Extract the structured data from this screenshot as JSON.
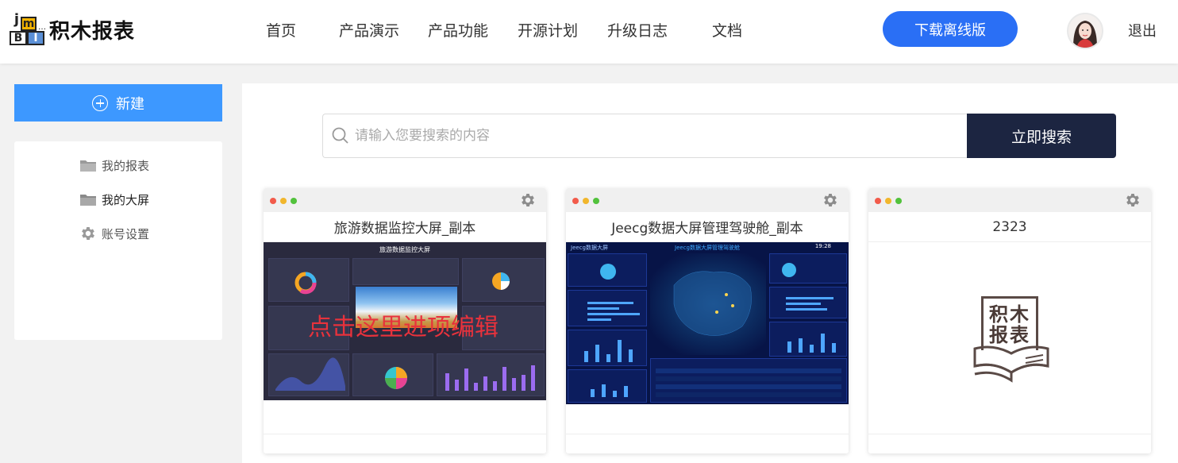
{
  "header": {
    "logo_text": "积木报表",
    "logo_blocks": [
      "j",
      "m",
      "B",
      "I"
    ],
    "nav": [
      "首页",
      "产品演示",
      "产品功能",
      "开源计划",
      "升级日志",
      "文档"
    ],
    "download_label": "下载离线版",
    "logout_label": "退出",
    "accent": "#2a6ff5"
  },
  "sidebar": {
    "new_label": "新建",
    "items": [
      {
        "label": "我的报表",
        "icon": "folder-icon"
      },
      {
        "label": "我的大屏",
        "icon": "folder-icon",
        "active": true
      },
      {
        "label": "账号设置",
        "icon": "gear-icon"
      }
    ]
  },
  "search": {
    "placeholder": "请输入您要搜索的内容",
    "value": "",
    "button_label": "立即搜索"
  },
  "cards": [
    {
      "title": "旅游数据监控大屏_副本",
      "thumb_title": "旅游数据监控大屏",
      "overlay_text": "点击这里进项编辑"
    },
    {
      "title": "Jeecg数据大屏管理驾驶舱_副本",
      "thumb_title": "Jeecg数据大屏管理驾驶舱",
      "thumb_brand": "Jeecg数据大屏",
      "thumb_time": "19:28"
    },
    {
      "title": "2323",
      "thumb_logo": "积木报表"
    }
  ]
}
